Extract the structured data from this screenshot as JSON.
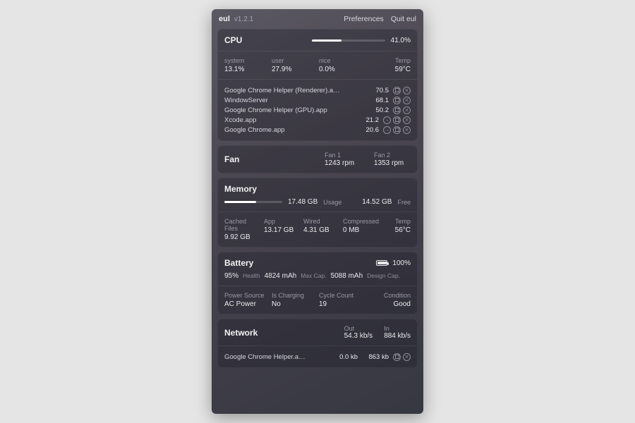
{
  "app": {
    "name": "eul",
    "version": "v1.2.1"
  },
  "menu": {
    "preferences": "Preferences",
    "quit": "Quit eul"
  },
  "cpu": {
    "title": "CPU",
    "usage_pct": 41.0,
    "usage_label": "41.0%",
    "stats": {
      "system": {
        "label": "system",
        "value": "13.1%"
      },
      "user": {
        "label": "user",
        "value": "27.9%"
      },
      "nice": {
        "label": "nice",
        "value": "0.0%"
      },
      "temp": {
        "label": "Temp",
        "value": "59°C"
      }
    },
    "processes": [
      {
        "name": "Google Chrome Helper (Renderer).a…",
        "value": "70.5",
        "icons": [
          "sq",
          "x"
        ]
      },
      {
        "name": "WindowServer",
        "value": "68.1",
        "icons": [
          "sq",
          "x"
        ]
      },
      {
        "name": "Google Chrome Helper (GPU).app",
        "value": "50.2",
        "icons": [
          "sq",
          "x"
        ]
      },
      {
        "name": "Xcode.app",
        "value": "21.2",
        "icons": [
          "ar",
          "sq",
          "x"
        ]
      },
      {
        "name": "Google Chrome.app",
        "value": "20.6",
        "icons": [
          "ar",
          "sq",
          "x"
        ]
      }
    ]
  },
  "fan": {
    "title": "Fan",
    "fans": [
      {
        "label": "Fan 1",
        "value": "1243 rpm"
      },
      {
        "label": "Fan 2",
        "value": "1353 rpm"
      }
    ]
  },
  "memory": {
    "title": "Memory",
    "used_pct": 54.6,
    "usage_value": "17.48 GB",
    "usage_label": "Usage",
    "free_value": "14.52 GB",
    "free_label": "Free",
    "stats": {
      "cached": {
        "label": "Cached Files",
        "value": "9.92 GB"
      },
      "app": {
        "label": "App",
        "value": "13.17 GB"
      },
      "wired": {
        "label": "Wired",
        "value": "4.31 GB"
      },
      "compressed": {
        "label": "Compressed",
        "value": "0 MB"
      },
      "temp": {
        "label": "Temp",
        "value": "56°C"
      }
    }
  },
  "battery": {
    "title": "Battery",
    "level_pct": 100,
    "level_label": "100%",
    "health_value": "95%",
    "health_label": "Health",
    "maxcap_value": "4824 mAh",
    "maxcap_label": "Max Cap.",
    "design_value": "5088 mAh",
    "design_label": "Design Cap.",
    "stats": {
      "source": {
        "label": "Power Source",
        "value": "AC Power"
      },
      "charging": {
        "label": "Is Charging",
        "value": "No"
      },
      "cycles": {
        "label": "Cycle Count",
        "value": "19"
      },
      "condition": {
        "label": "Condition",
        "value": "Good"
      }
    }
  },
  "network": {
    "title": "Network",
    "out": {
      "label": "Out",
      "value": "54.3 kb/s"
    },
    "in": {
      "label": "In",
      "value": "884 kb/s"
    },
    "processes": [
      {
        "name": "Google Chrome Helper.a…",
        "out": "0.0 kb",
        "in": "863 kb",
        "icons": [
          "sq",
          "x"
        ]
      }
    ]
  }
}
